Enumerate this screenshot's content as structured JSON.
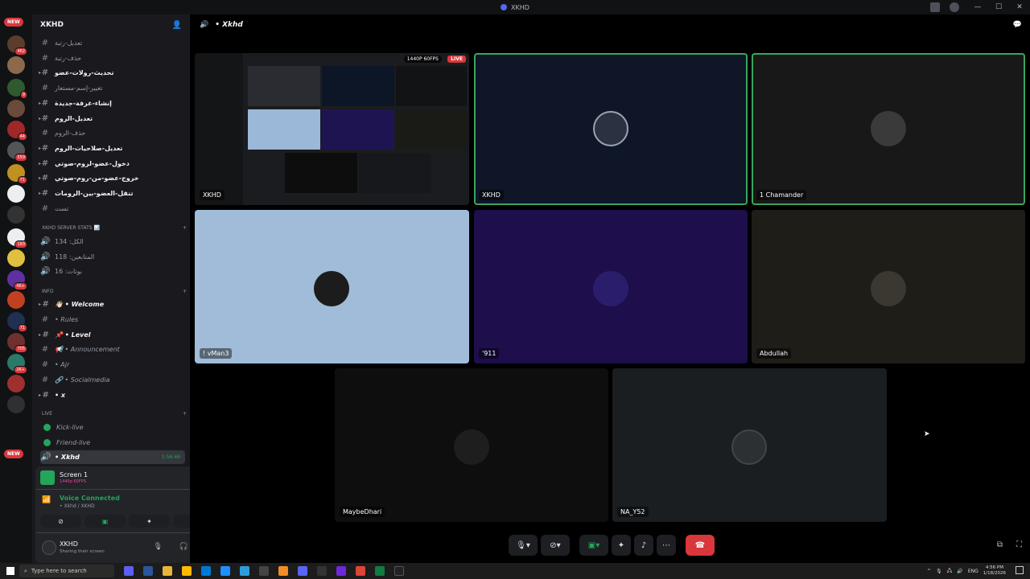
{
  "window": {
    "title": "XKHD",
    "min": "—",
    "max": "☐",
    "close": "✕"
  },
  "servers": {
    "new_top": "NEW",
    "new_bottom": "NEW",
    "badges": [
      "462",
      "",
      "9",
      "",
      "44",
      "559",
      "71",
      "",
      "",
      "193",
      "",
      "4K+",
      "",
      "71",
      "705",
      "2K+",
      "",
      ""
    ]
  },
  "sidebar": {
    "server_name": "XKHD",
    "top_channels": [
      {
        "name": "تعديل-رتبة",
        "style": "muted"
      },
      {
        "name": "حذف-رتبة",
        "style": "muted"
      },
      {
        "name": "تحديث-رولات-عضو",
        "style": "bold"
      },
      {
        "name": "تغيير-إسم-مستعار",
        "style": "muted"
      },
      {
        "name": "إنشاء-غرفة-جديدة",
        "style": "bold"
      },
      {
        "name": "تعديل-الروم",
        "style": "bold"
      },
      {
        "name": "حذف-الروم",
        "style": "muted"
      },
      {
        "name": "تعديل-صلاحيات-الروم",
        "style": "bold"
      },
      {
        "name": "دخول-عضو-لروم-صوتي",
        "style": "bold"
      },
      {
        "name": "خروج-عضو-من-روم-صوتي",
        "style": "bold"
      },
      {
        "name": "تنقل-العضو-بين-الرومات",
        "style": "bold"
      },
      {
        "name": "تست",
        "style": "muted"
      }
    ],
    "stats_category": "XKHD SERVER STATS 📊",
    "stats": [
      "الكل: 134",
      "المتابعين: 118",
      "بوتات: 16"
    ],
    "info_category": "INFO",
    "info_channels": [
      {
        "name": "👋🏻 • Welcome",
        "style": "bold"
      },
      {
        "name": "• Rules",
        "style": "muted"
      },
      {
        "name": "📌 • Level",
        "style": "bold"
      },
      {
        "name": "📢 • Announcement",
        "style": "muted"
      },
      {
        "name": "• Ajr",
        "style": "muted"
      },
      {
        "name": "🔗 • Socialmedia",
        "style": "muted"
      },
      {
        "name": "• x",
        "style": "bold"
      }
    ],
    "live_category": "LIVE",
    "live_channels": [
      "Kick-live",
      "Friend-live"
    ],
    "active_voice": {
      "name": "• Xkhd",
      "time": "1:56:46"
    }
  },
  "stream_panel": {
    "title": "Screen 1",
    "sub": "1440p 60FPS"
  },
  "voice_panel": {
    "status": "Voice Connected",
    "location": "• Xkhd / XKHD"
  },
  "user_panel": {
    "name": "XKHD",
    "status": "Sharing their screen"
  },
  "main": {
    "channel_title": "• Xkhd",
    "stream_badge": "1440P 60FPS",
    "live_badge": "LIVE",
    "tiles": [
      {
        "label": "XKHD",
        "kind": "stream"
      },
      {
        "label": "XKHD",
        "kind": "avatar"
      },
      {
        "label": "1 Chamander",
        "kind": "avatar"
      },
      {
        "label": "! vMan3",
        "kind": "avatar"
      },
      {
        "label": "'911",
        "kind": "avatar"
      },
      {
        "label": "Abdullah",
        "kind": "avatar"
      },
      {
        "label": "MaybeDhari",
        "kind": "avatar"
      },
      {
        "label": "NA_Y52",
        "kind": "avatar"
      }
    ]
  },
  "taskbar": {
    "search_placeholder": "Type here to search",
    "lang": "ENG",
    "time": "4:56 PM",
    "date": "1/18/2026"
  },
  "colors": {
    "green": "#23a55a",
    "red": "#da373c",
    "blurple": "#5865f2"
  }
}
